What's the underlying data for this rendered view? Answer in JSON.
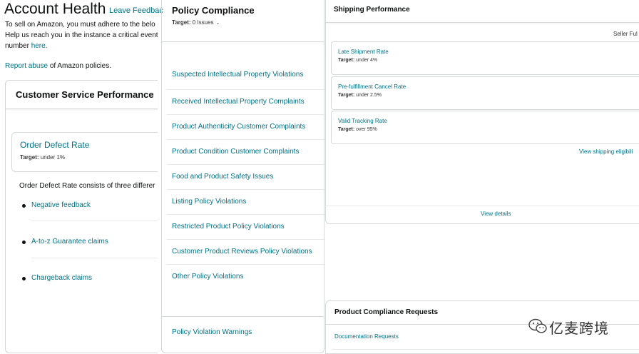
{
  "header": {
    "title": "Account Health",
    "feedback_link": "Leave Feedbac",
    "intro_line1": "To sell on Amazon, you must adhere to the belo",
    "intro_line2": "Help us reach you in the instance a critical event",
    "intro_line3_prefix": "number ",
    "intro_line3_link": "here.",
    "report_link": "Report abuse",
    "report_suffix": " of Amazon policies."
  },
  "customer_service": {
    "title": "Customer Service Performance",
    "metric_name": "Order Defect Rate",
    "metric_target_label": "Target:",
    "metric_target_value": " under 1%",
    "description": "Order Defect Rate consists of three differer",
    "items": [
      {
        "label": "Negative feedback"
      },
      {
        "label": "A-to-z Guarantee claims"
      },
      {
        "label": "Chargeback claims"
      }
    ]
  },
  "policy_compliance": {
    "title": "Policy Compliance",
    "target_label": "Target:",
    "target_value": " 0 Issues",
    "items": [
      {
        "label": "Suspected Intellectual Property Violations"
      },
      {
        "label": "Received Intellectual Property Complaints"
      },
      {
        "label": "Product Authenticity Customer Complaints"
      },
      {
        "label": "Product Condition Customer Complaints"
      },
      {
        "label": "Food and Product Safety Issues"
      },
      {
        "label": "Listing Policy Violations"
      },
      {
        "label": "Restricted Product Policy Violations"
      },
      {
        "label": "Customer Product Reviews Policy Violations"
      },
      {
        "label": "Other Policy Violations"
      }
    ],
    "warnings_label": "Policy Violation Warnings"
  },
  "shipping": {
    "title": "Shipping Performance",
    "seller_label": "Seller Ful",
    "metrics": [
      {
        "name": "Late Shipment Rate",
        "target_label": "Target:",
        "target_value": " under 4%"
      },
      {
        "name": "Pre-fulfillment Cancel Rate",
        "target_label": "Target:",
        "target_value": " under 2.5%"
      },
      {
        "name": "Valid Tracking Rate",
        "target_label": "Target:",
        "target_value": " over 95%"
      }
    ],
    "eligibility_link": "View shipping eligibili",
    "details_link": "View details"
  },
  "product_compliance": {
    "title": "Product Compliance Requests",
    "doc_link": "Documentation Requests"
  },
  "watermark": {
    "text": "亿麦跨境",
    "icon": "wechat-icon"
  },
  "colors": {
    "link": "#007185",
    "border": "#d5d9d9",
    "text": "#0f1111"
  }
}
